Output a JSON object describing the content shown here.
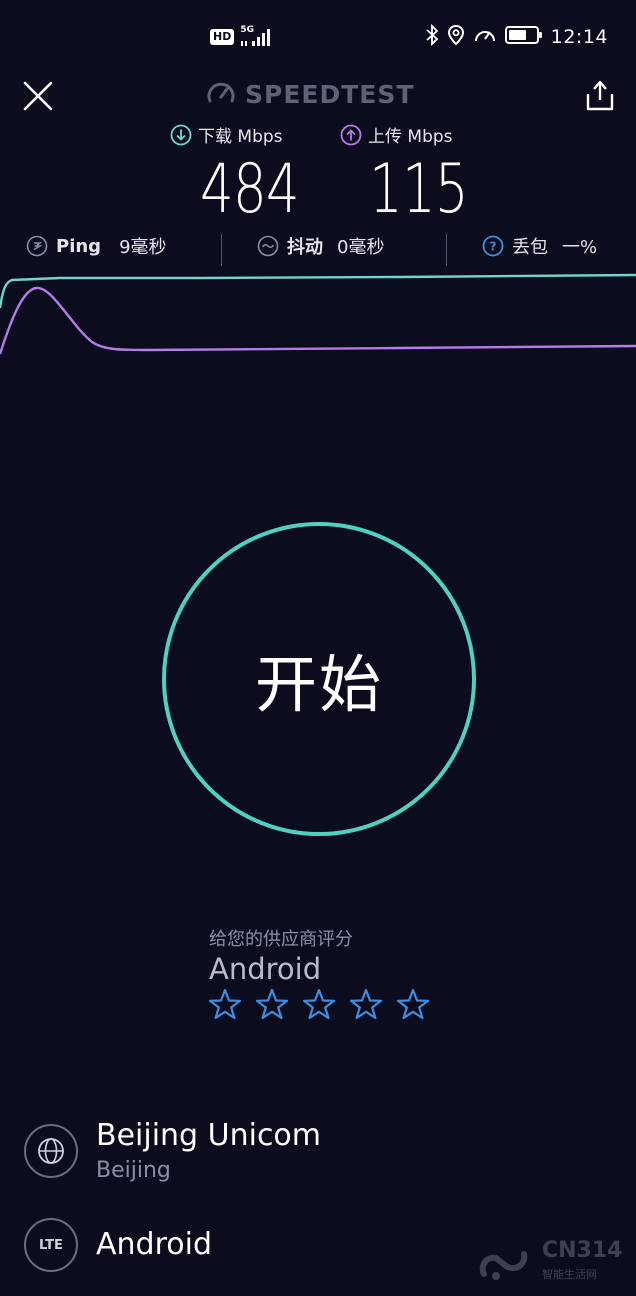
{
  "status_bar": {
    "hd_badge": "HD",
    "network_tag": "5G",
    "time": "12:14"
  },
  "header": {
    "brand": "SPEEDTEST"
  },
  "results": {
    "download": {
      "label": "下载 Mbps",
      "value": "484"
    },
    "upload": {
      "label": "上传 Mbps",
      "value": "115"
    }
  },
  "metrics": {
    "ping": {
      "label": "Ping",
      "value": "9毫秒"
    },
    "jitter": {
      "label": "抖动",
      "value": "0毫秒"
    },
    "packet_loss": {
      "label": "丢包",
      "value": "一%"
    }
  },
  "start_button": {
    "label": "开始"
  },
  "rating": {
    "prompt": "给您的供应商评分",
    "provider": "Android",
    "stars_total": 5,
    "stars_filled": 0
  },
  "server": {
    "isp": "Beijing Unicom",
    "city": "Beijing"
  },
  "connection": {
    "type_label": "LTE",
    "device": "Android"
  },
  "watermark": {
    "text": "CN314",
    "sub": "智能生活网"
  },
  "colors": {
    "background": "#0b0d1f",
    "download_accent": "#6fd6c9",
    "upload_accent": "#b57be6",
    "start_ring": "#4fd1c1",
    "star_outline": "#3d8ee0"
  }
}
